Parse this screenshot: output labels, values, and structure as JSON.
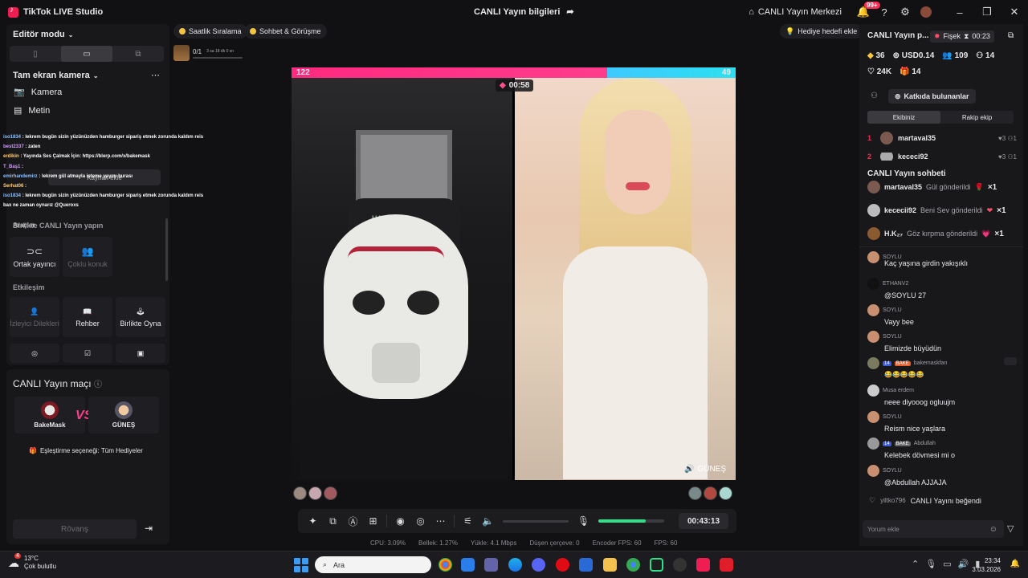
{
  "window": {
    "app_title": "TikTok LIVE Studio",
    "center_title": "CANLI Yayın bilgileri",
    "live_center": "CANLI Yayın Merkezi",
    "notification_count": "99+"
  },
  "left_panel": {
    "editor_mode": "Editör modu",
    "camera_section": "Tam ekran kamera",
    "sources": [
      "Kamera",
      "Metin"
    ],
    "add_source": "Kaynak ekle",
    "tools_header": "Araçlar",
    "collab_header": "Birlikte CANLI Yayın yapın",
    "collab_tiles": [
      "Ortak yayıncı",
      "Çoklu konuk"
    ],
    "interaction_header": "Etkileşim",
    "interaction_tiles": [
      "İzleyici Dilekleri",
      "Rehber",
      "Birlikte Oyna"
    ]
  },
  "overlay_chat": [
    {
      "user": "iso1834",
      "text": ": lekrem bugün sizin yüzünüzden hamburger sipariş etmek zorunda kaldım reis"
    },
    {
      "user": "best2337",
      "text": ": zaten"
    },
    {
      "user": "erdikin",
      "text": ": Yayında Ses Çalmak İçin: https://blerp.com/x/bakemask"
    },
    {
      "user": "T_Baş1",
      "text": ":"
    },
    {
      "user": "emirhandemirz",
      "text": ": lekrem gül atmayla isteme yayını burası"
    },
    {
      "user": "Serhat06",
      "text": ":"
    },
    {
      "user": "iso1834",
      "text": ": lekrem bugün sizin yüzünüzden hamburger sipariş etmek zorunda kaldım reis"
    },
    {
      "user": "",
      "text": "bax ne zaman oynarız @Queroxs"
    }
  ],
  "match_panel": {
    "title": "CANLI Yayın maçı",
    "player_left": "BakeMask",
    "vs": "VS",
    "player_right": "GÜNEŞ",
    "pairing": "Eşleştirme seçeneği: Tüm Hediyeler",
    "rematch": "Rövanş"
  },
  "center": {
    "pill_hourly": "Saatlik Sıralama",
    "pill_chat": "Sohbet & Görüşme",
    "gift_goal_progress": "0/1",
    "gift_goal_time": "3 sa 18 dk 0 sn",
    "add_gift_goal": "Hediye hedefi ekle",
    "score_left": "122",
    "score_right": "49",
    "battle_timer": "00:58",
    "right_streamer_tag": "GÜNEŞ",
    "left_video_text": "HAWK",
    "mic_level": 0.72,
    "stream_time": "00:43:13"
  },
  "stats": {
    "cpu": "CPU: 3.09%",
    "memory": "Bellek: 1.27%",
    "upload": "Yükle: 4.1 Mbps",
    "dropped": "Düşen çerçeve: 0",
    "encoder_fps": "Encoder FPS: 60",
    "fps": "FPS: 60"
  },
  "right_panel": {
    "live_title": "CANLI Yayın p...",
    "fisek": "Fişek",
    "fisek_time": "00:23",
    "diamonds": "36",
    "usd": "USD0.14",
    "viewers": "109",
    "people": "14",
    "likes": "24K",
    "gifts": "14",
    "contributors_btn": "Katkıda bulunanlar",
    "tab_our_team": "Ekibiniz",
    "tab_rival_team": "Rakip ekip",
    "ranking": [
      {
        "rank": "1",
        "name": "martaval35",
        "likes": "3",
        "gifts": "1"
      },
      {
        "rank": "2",
        "name": "kececi92",
        "likes": "3",
        "gifts": "1"
      }
    ],
    "chat_title": "CANLI Yayın sohbeti",
    "gift_events": [
      {
        "name": "martaval35",
        "action": "Gül gönderildi",
        "count": "×1"
      },
      {
        "name": "kececii92",
        "action": "Beni Sev gönderildi",
        "count": "×1"
      },
      {
        "name": "H.K₂₇",
        "action": "Göz kırpma gönderildi",
        "count": "×1"
      }
    ],
    "messages": [
      {
        "user": "SOYLU",
        "text": "Kaç yaşına girdin yakışıklı"
      },
      {
        "user": "ETHANV2",
        "text": "@SOYLU 27"
      },
      {
        "user": "SOYLU",
        "text": "Vayy bee"
      },
      {
        "user": "SOYLU",
        "text": "Elimizde büyüdün"
      },
      {
        "user": "bakemaskfan",
        "level": "14",
        "team": "BAKE",
        "text": "😂😂😂😂😂"
      },
      {
        "user": "Musa erdem",
        "text": "neee diyooog ogluujm"
      },
      {
        "user": "SOYLU",
        "text": "Reism nice yaşlara"
      },
      {
        "user": "Abdullah",
        "level": "14",
        "team": "BAKE",
        "text": "Kelebek dövmesi mi o"
      },
      {
        "user": "SOYLU",
        "text": "@Abdullah AJJAJA"
      }
    ],
    "like_user": "yiltko796",
    "like_text": "CANLI Yayını beğendi",
    "comment_placeholder": "Yorum ekle"
  },
  "taskbar": {
    "temp": "13°C",
    "weather": "Çok bulutlu",
    "weather_badge": "4",
    "search": "Ara",
    "time": "23:34",
    "date": "3.03.2026"
  },
  "colors": {
    "accent_pink": "#fe2c55",
    "score_left": "#ff2a7f",
    "score_right": "#3ec9ff",
    "mic_green": "#2ee08a"
  }
}
